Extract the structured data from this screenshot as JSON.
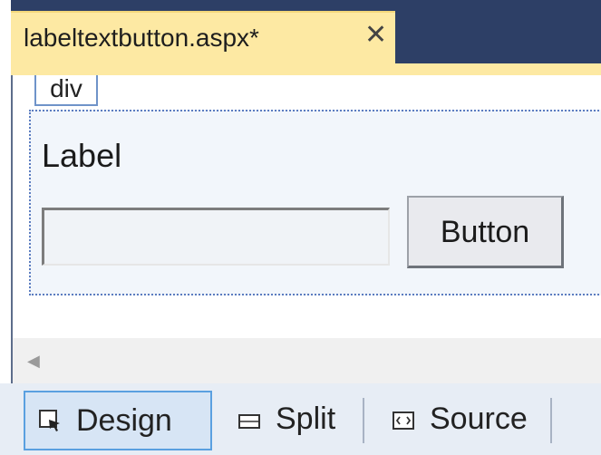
{
  "tab": {
    "title": "labeltextbutton.aspx*",
    "close": "✕"
  },
  "design": {
    "div_tag": "div",
    "label": "Label",
    "button": "Button",
    "textbox_value": ""
  },
  "view_switcher": {
    "design": "Design",
    "split": "Split",
    "source": "Source",
    "active": "Design"
  },
  "scroll": {
    "left_arrow": "◀"
  }
}
